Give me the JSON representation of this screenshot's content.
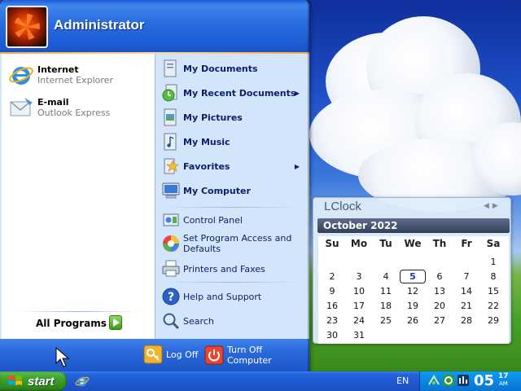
{
  "user": {
    "name": "Administrator"
  },
  "pinned": [
    {
      "title": "Internet",
      "subtitle": "Internet Explorer",
      "icon": "internet-explorer-icon"
    },
    {
      "title": "E-mail",
      "subtitle": "Outlook Express",
      "icon": "outlook-express-icon"
    }
  ],
  "all_programs": {
    "label": "All Programs"
  },
  "places": [
    {
      "label": "My Documents",
      "icon": "my-documents-icon"
    },
    {
      "label": "My Recent Documents",
      "icon": "recent-documents-icon",
      "submenu": true
    },
    {
      "label": "My Pictures",
      "icon": "my-pictures-icon"
    },
    {
      "label": "My Music",
      "icon": "my-music-icon"
    },
    {
      "label": "Favorites",
      "icon": "favorites-icon",
      "submenu": true
    },
    {
      "label": "My Computer",
      "icon": "my-computer-icon"
    }
  ],
  "settings": [
    {
      "label": "Control Panel",
      "icon": "control-panel-icon"
    },
    {
      "label": "Set Program Access and Defaults",
      "icon": "program-access-icon"
    },
    {
      "label": "Printers and Faxes",
      "icon": "printers-icon"
    }
  ],
  "help": [
    {
      "label": "Help and Support",
      "icon": "help-icon"
    },
    {
      "label": "Search",
      "icon": "search-icon"
    }
  ],
  "footer": {
    "logoff": "Log Off",
    "turnoff": "Turn Off Computer"
  },
  "taskbar": {
    "start": "start",
    "lang": "EN",
    "time_hm": "05",
    "time_min": "17",
    "time_ampm": "AM"
  },
  "lclock": {
    "title": "LClock",
    "month": "October 2022",
    "weekdays": [
      "Su",
      "Mo",
      "Tu",
      "We",
      "Th",
      "Fr",
      "Sa"
    ],
    "first_weekday": 6,
    "days_in_month": 31,
    "today": 5
  },
  "colors": {
    "accent": "#1e5dd6",
    "start_green": "#3a9f2b",
    "menu_right_bg": "#d3e5fa"
  }
}
